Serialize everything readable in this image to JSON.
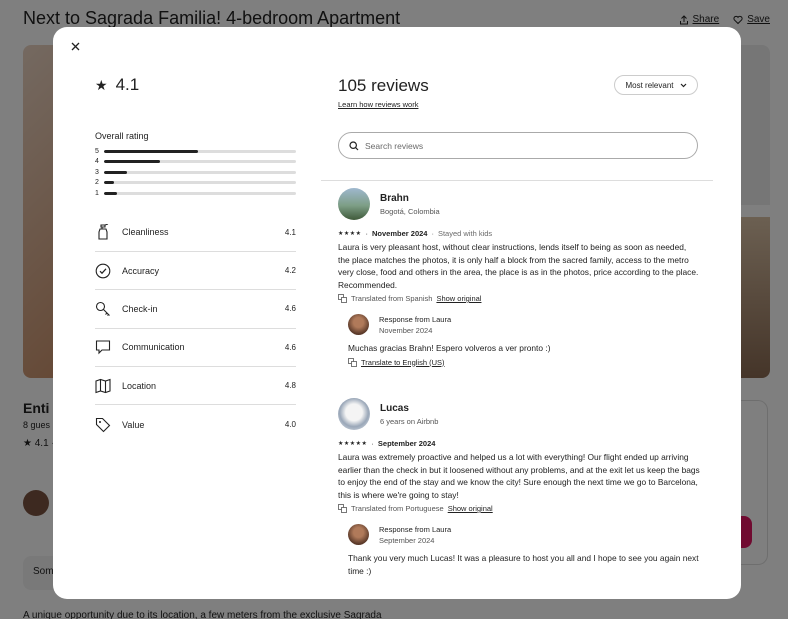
{
  "background": {
    "title": "Next to Sagrada Familia! 4-bedroom Apartment",
    "share_label": "Share",
    "save_label": "Save",
    "subtitle_fragment": "Enti",
    "guests_fragment": "8 gues",
    "rating_fragment": "★ 4.1 ·",
    "pill_fragment": "Som",
    "description_fragment": "A unique opportunity due to its location, a few meters from the exclusive Sagrada"
  },
  "modal": {
    "close_icon": "close-icon",
    "average_rating": "4.1",
    "overall_label": "Overall rating",
    "distribution": [
      {
        "stars": "5",
        "fraction": 0.49
      },
      {
        "stars": "4",
        "fraction": 0.29
      },
      {
        "stars": "3",
        "fraction": 0.12
      },
      {
        "stars": "2",
        "fraction": 0.05
      },
      {
        "stars": "1",
        "fraction": 0.07
      }
    ],
    "categories": [
      {
        "label": "Cleanliness",
        "value": "4.1",
        "icon": "spray-bottle-icon"
      },
      {
        "label": "Accuracy",
        "value": "4.2",
        "icon": "check-circle-icon"
      },
      {
        "label": "Check-in",
        "value": "4.6",
        "icon": "key-icon"
      },
      {
        "label": "Communication",
        "value": "4.6",
        "icon": "message-icon"
      },
      {
        "label": "Location",
        "value": "4.8",
        "icon": "map-icon"
      },
      {
        "label": "Value",
        "value": "4.0",
        "icon": "tag-icon"
      }
    ],
    "reviews_title": "105 reviews",
    "learn_link": "Learn how reviews work",
    "sort_label": "Most relevant",
    "search_placeholder": "Search reviews",
    "reviews": [
      {
        "name": "Brahn",
        "location": "Bogotá, Colombia",
        "stars": "★★★★",
        "date": "November 2024",
        "extra": "Stayed with kids",
        "text": "Laura is very pleasant host, without clear instructions, lends itself to being as soon as needed, the place matches the photos, it is only half a block from the sacred family, access to the metro very close, food and others in the area, the place is as in the photos, price according to the place. Recommended.",
        "translated": "Translated from Spanish",
        "show_original": "Show original",
        "response": {
          "name": "Response from Laura",
          "date": "November 2024",
          "text": "Muchas gracias Brahn! Espero volveros a ver pronto :)",
          "translate_link": "Translate to English (US)"
        }
      },
      {
        "name": "Lucas",
        "location": "6 years on Airbnb",
        "stars": "★★★★★",
        "date": "September 2024",
        "extra": "",
        "text": "Laura was extremely proactive and helped us a lot with everything! Our flight ended up arriving earlier than the check in but it loosened without any problems, and at the exit let us keep the bags to enjoy the end of the stay and we know the city! Sure enough the next time we go to Barcelona, this is where we're going to stay!",
        "translated": "Translated from Portuguese",
        "show_original": "Show original",
        "response": {
          "name": "Response from Laura",
          "date": "September 2024",
          "text": "Thank you very much Lucas! It was a pleasure to host you all and I hope to see you again next time :)",
          "translate_link": ""
        }
      }
    ]
  }
}
